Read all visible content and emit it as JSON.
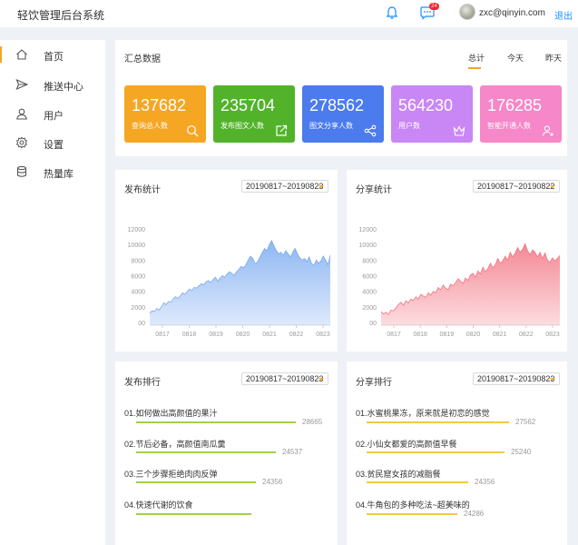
{
  "header": {
    "title": "轻饮管理后台系统",
    "badge": "24",
    "user": "zxc@qinyin.com",
    "logout": "退出"
  },
  "sidebar": {
    "items": [
      {
        "label": "首页",
        "icon": "home-icon"
      },
      {
        "label": "推送中心",
        "icon": "send-icon"
      },
      {
        "label": "用户",
        "icon": "user-icon"
      },
      {
        "label": "设置",
        "icon": "gear-icon"
      },
      {
        "label": "热量库",
        "icon": "database-icon"
      }
    ]
  },
  "summary": {
    "title": "汇总数据",
    "tabs": [
      "总计",
      "今天",
      "昨天"
    ],
    "cards": [
      {
        "value": "137682",
        "label": "查询总人数",
        "color": "#f5a623",
        "icon": "search-icon"
      },
      {
        "value": "235704",
        "label": "发布图文人数",
        "color": "#52b32b",
        "icon": "share-out-icon"
      },
      {
        "value": "278562",
        "label": "图文分享人数",
        "color": "#4b7bec",
        "icon": "share-icon"
      },
      {
        "value": "564230",
        "label": "用户数",
        "color": "#c987f5",
        "icon": "crown-icon"
      },
      {
        "value": "176285",
        "label": "智能开通人数",
        "color": "#f687c8",
        "icon": "user-add-icon"
      }
    ]
  },
  "publish_stats": {
    "title": "发布统计",
    "range": "20190817~20190823"
  },
  "share_stats": {
    "title": "分享统计",
    "range": "20190817~20190822"
  },
  "publish_rank": {
    "title": "发布排行",
    "range": "20190817~20190823",
    "items": [
      {
        "label": "01.如何做出高颜值的果汁",
        "value": "28665"
      },
      {
        "label": "02.节后必备，高颜值南瓜羹",
        "value": "24537"
      },
      {
        "label": "03.三个步骤拒绝肉肉反弹",
        "value": "24356"
      },
      {
        "label": "04.快速代谢的饮食",
        "value": ""
      }
    ]
  },
  "share_rank": {
    "title": "分享排行",
    "range": "20190817~20190823",
    "items": [
      {
        "label": "01.水蜜桃果冻，原来就是初恋的感觉",
        "value": "27562"
      },
      {
        "label": "02.小仙女都爱的高颜值早餐",
        "value": "25240"
      },
      {
        "label": "03.贫民窟女孩的减脂餐",
        "value": "24356"
      },
      {
        "label": "04.牛角包的多种吃法~超美味的",
        "value": "24286"
      }
    ]
  },
  "chart_data": [
    {
      "type": "area",
      "x": [
        "0817",
        "0818",
        "0819",
        "0820",
        "0821",
        "0822",
        "0823"
      ],
      "yticks": [
        0,
        2000,
        4000,
        6000,
        8000,
        10000,
        12000
      ],
      "ylim": [
        0,
        12000
      ],
      "color": "#7aaaf0",
      "values": [
        1200,
        1500,
        1400,
        1800,
        1600,
        2000,
        2500,
        2300,
        2700,
        2600,
        3000,
        3300,
        3100,
        3400,
        3800,
        3600,
        4000,
        4300,
        4100,
        4500,
        4400,
        4700,
        5000,
        4800,
        5200,
        5400,
        5100,
        5500,
        5800,
        5300,
        5700,
        6000,
        5800,
        6200,
        6500,
        6300,
        6000,
        6500,
        6800,
        7200,
        7000,
        7400,
        8000,
        8500,
        8200,
        7500,
        7800,
        8400,
        9000,
        9500,
        9200,
        10000,
        10500,
        9800,
        9200,
        8800,
        9000,
        8600,
        9200,
        8800,
        8400,
        9000,
        9500,
        8800,
        8300,
        8000,
        8200,
        7800,
        8400,
        7600,
        7300,
        8000,
        7600,
        7900,
        8500,
        8000,
        7400,
        8600
      ]
    },
    {
      "type": "area",
      "x": [
        "0817",
        "0818",
        "0819",
        "0820",
        "0821",
        "0822",
        "0823"
      ],
      "yticks": [
        0,
        2000,
        4000,
        6000,
        8000,
        10000,
        12000
      ],
      "ylim": [
        0,
        12000
      ],
      "color": "#f27482",
      "values": [
        1400,
        1100,
        1300,
        1000,
        1600,
        1500,
        1900,
        2300,
        2600,
        2200,
        2800,
        2500,
        3000,
        2800,
        3300,
        3000,
        3600,
        3400,
        3200,
        3800,
        3500,
        4000,
        3800,
        4500,
        4200,
        4800,
        4400,
        4200,
        4900,
        4700,
        5100,
        5600,
        5300,
        5000,
        5700,
        5400,
        6100,
        6300,
        5800,
        6600,
        6200,
        7100,
        6500,
        6900,
        7600,
        7000,
        7400,
        8200,
        7600,
        7900,
        8500,
        8000,
        9000,
        8400,
        8900,
        9600,
        9000,
        9400,
        10100,
        9200,
        8700,
        9300,
        9000,
        8400,
        9000,
        8200,
        8900,
        8000,
        7700,
        8300,
        7900,
        8200,
        8600
      ]
    }
  ]
}
